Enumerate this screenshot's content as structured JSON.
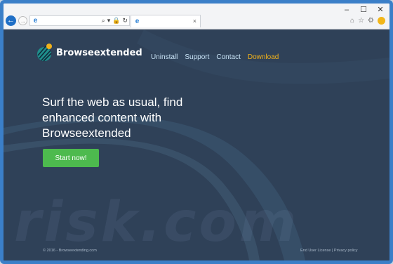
{
  "browser": {
    "window_controls": [
      "–",
      "☐",
      "✕"
    ],
    "back_glyph": "←",
    "forward_glyph": "→",
    "address_tools": [
      "⌕",
      "▾",
      "🔒",
      "↻"
    ],
    "tab_close": "×",
    "toolbar_icons": [
      "⌂",
      "☆",
      "⚙"
    ]
  },
  "site": {
    "logo_text": "Browseextended",
    "nav": {
      "uninstall": "Uninstall",
      "support": "Support",
      "contact": "Contact",
      "download": "Download"
    },
    "headline": "Surf the web as usual, find enhanced content with Browseextended",
    "cta_label": "Start now!",
    "footer_copyright": "© 2016 - Browseextending.com",
    "footer_links": "End User License | Privacy policy",
    "watermark": "risk.com"
  },
  "colors": {
    "background": "#2f4158",
    "accent_download": "#f2b21a",
    "cta": "#4dba4e",
    "frame": "#3b7fc8"
  }
}
